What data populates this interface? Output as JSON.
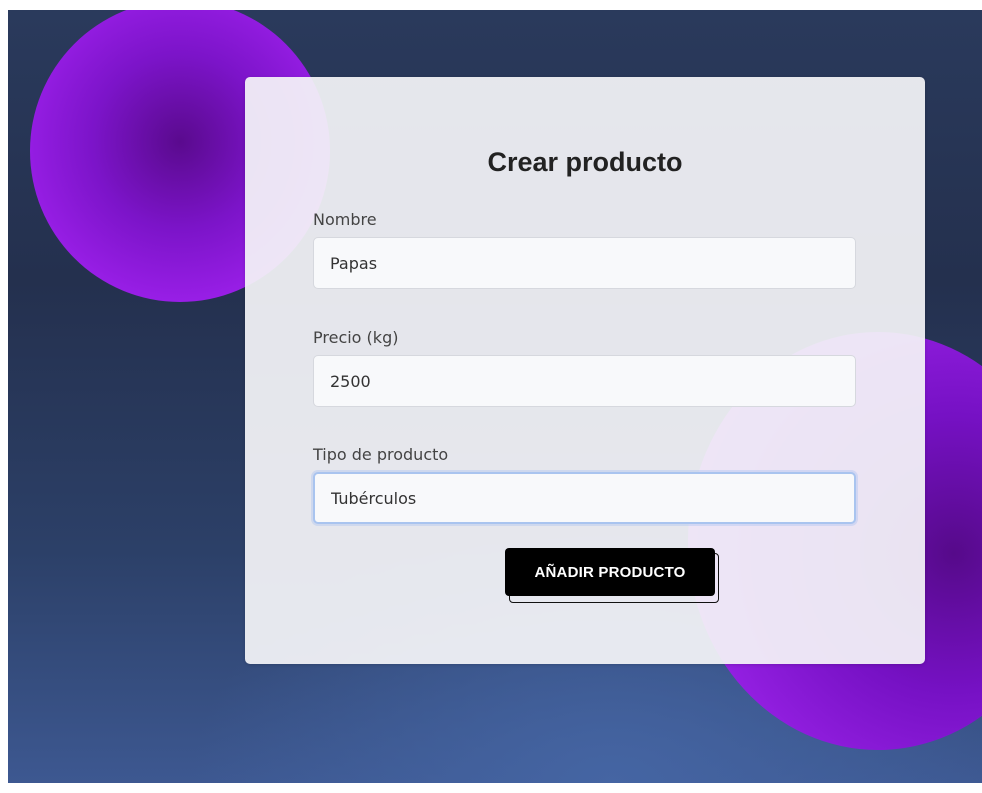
{
  "colors": {
    "background_dark": "#24304e",
    "background_light": "#4565a3",
    "blob_purple": "#9a1fe8",
    "card_bg": "#f4f4f8",
    "button_bg": "#000000",
    "button_text": "#ffffff",
    "focus_border": "#a9c4ef"
  },
  "form": {
    "title": "Crear producto",
    "fields": [
      {
        "label": "Nombre",
        "value": "Papas"
      },
      {
        "label": "Precio (kg)",
        "value": "2500"
      },
      {
        "label": "Tipo de producto",
        "value": "Tubérculos",
        "focused": true
      }
    ],
    "submit_label": "AÑADIR PRODUCTO"
  }
}
